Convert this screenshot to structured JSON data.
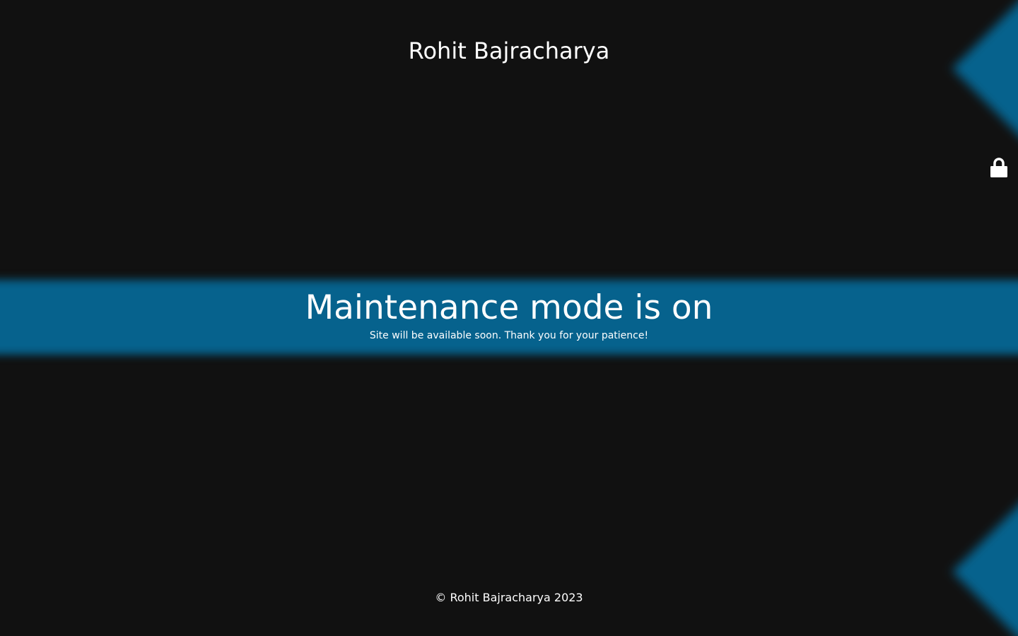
{
  "header": {
    "site_title": "Rohit Bajracharya"
  },
  "admin": {
    "lock_icon": "lock-icon"
  },
  "main": {
    "heading": "Maintenance mode is on",
    "subtext": "Site will be available soon. Thank you for your patience!"
  },
  "footer": {
    "copyright": "© Rohit Bajracharya 2023"
  },
  "colors": {
    "background": "#111111",
    "accent": "#06628d",
    "text": "#ffffff"
  }
}
